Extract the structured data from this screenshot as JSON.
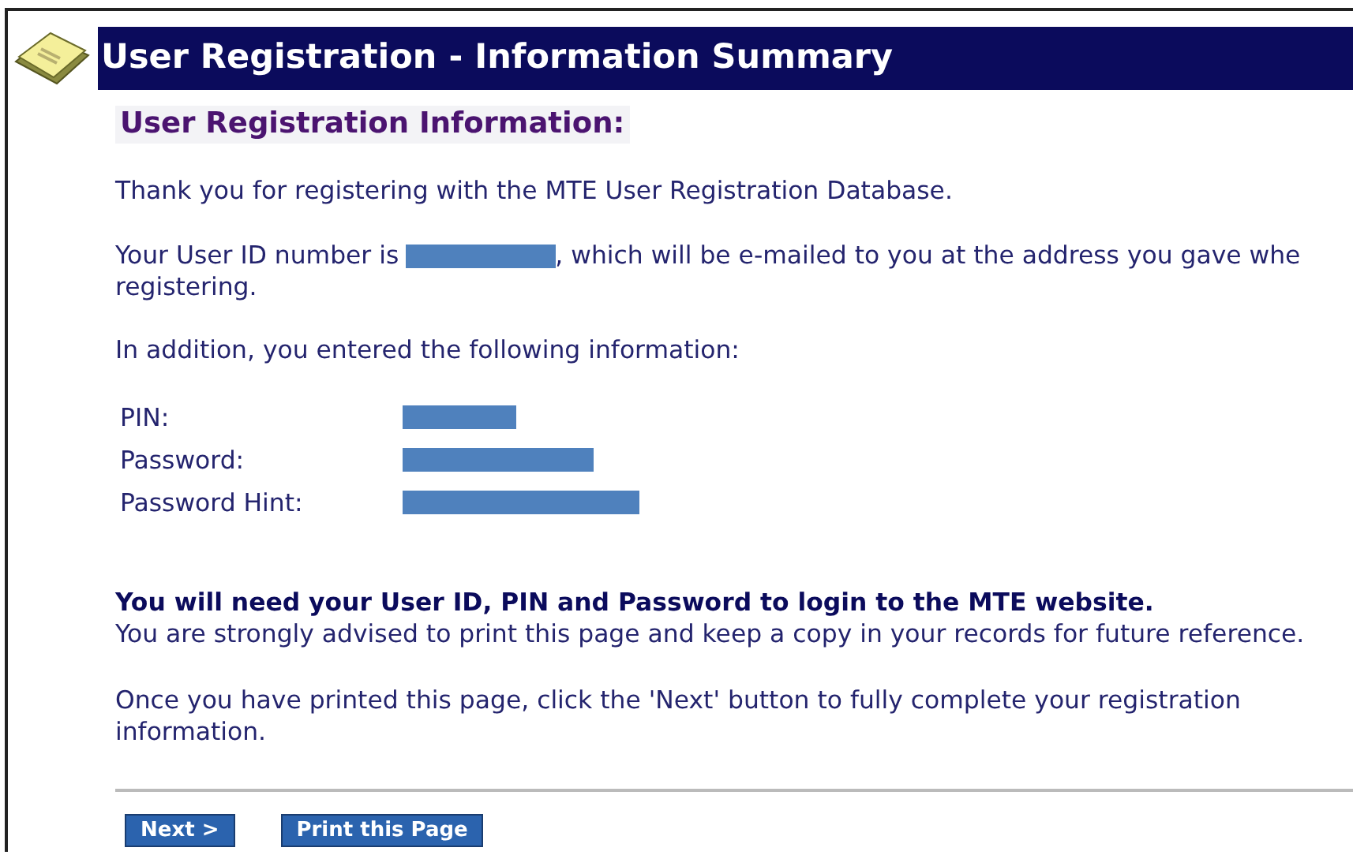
{
  "header": {
    "title": "User Registration - Information Summary"
  },
  "section_title": "User Registration Information:",
  "thanks": "Thank you for registering with the MTE User Registration Database.",
  "user_id_sentence": {
    "before": "Your User ID number is",
    "after": ", which will be e-mailed to you at the address you gave whe",
    "continued": "registering."
  },
  "intro": "In addition, you entered the following information:",
  "details": [
    {
      "label": "PIN:"
    },
    {
      "label": "Password:"
    },
    {
      "label": "Password Hint:"
    }
  ],
  "notice": "You will need your User ID, PIN and Password to login to the MTE website.",
  "advice": "You are strongly advised to print this page and keep a copy in your records for future reference.",
  "instructions": "Once you have printed this page, click the 'Next' button to fully complete your registration information.",
  "buttons": [
    "Next >",
    "Print this Page"
  ]
}
